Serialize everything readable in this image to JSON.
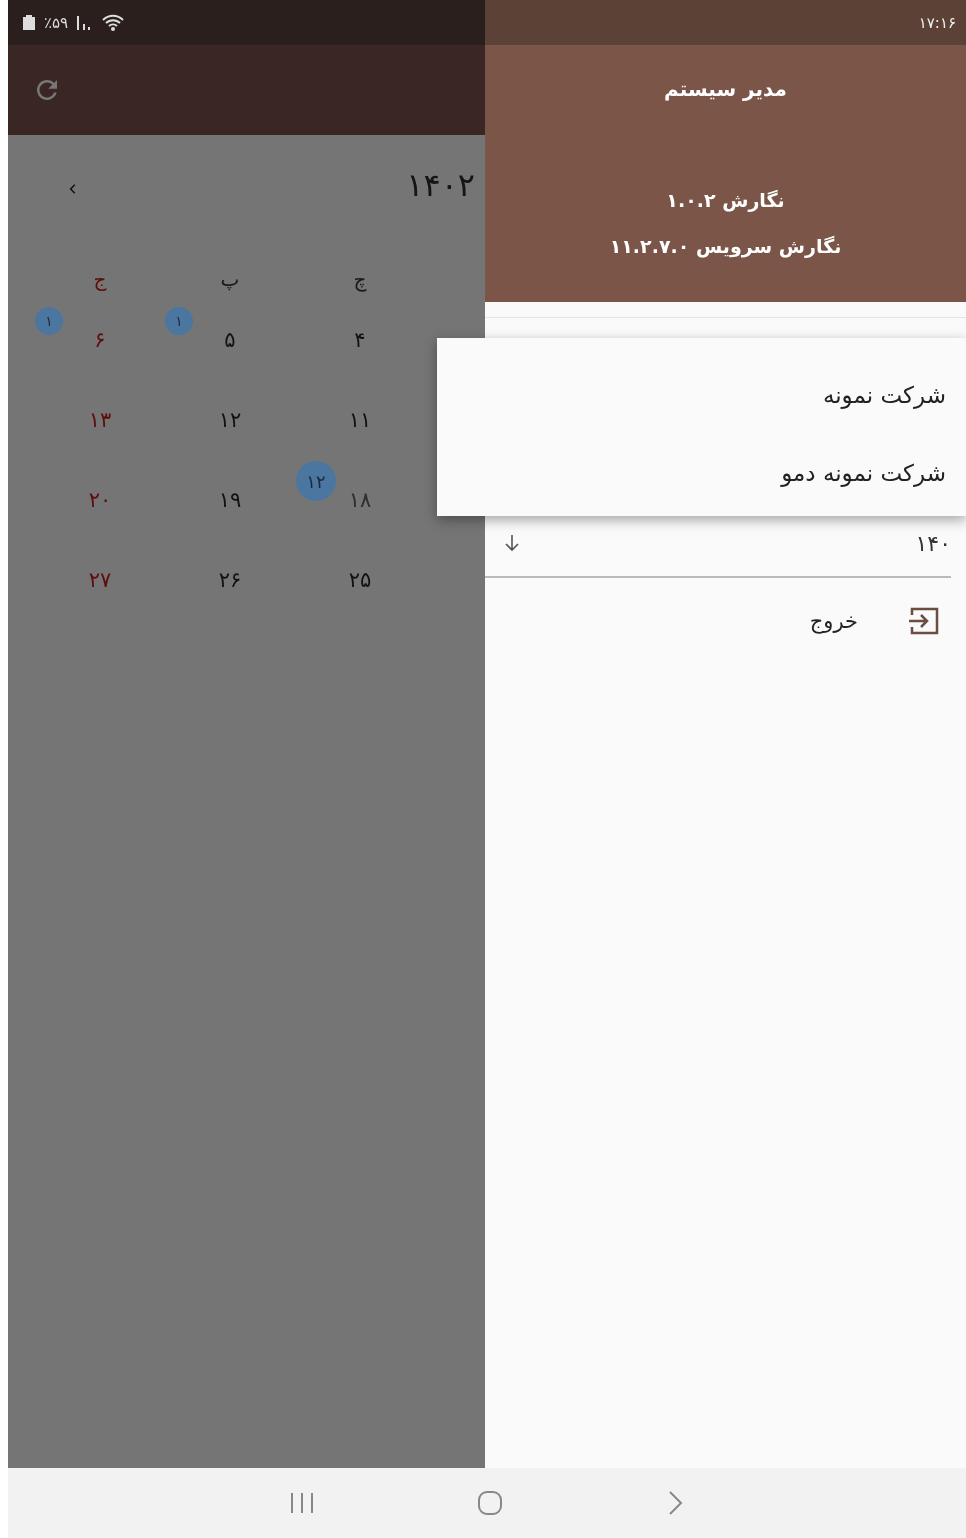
{
  "status_bar": {
    "battery": "٪۵۹",
    "time": "۱۷:۱۶"
  },
  "calendar": {
    "year": "۱۴۰۲",
    "weekdays": [
      {
        "label": "چ",
        "holiday": false
      },
      {
        "label": "پ",
        "holiday": false
      },
      {
        "label": "ج",
        "holiday": true
      }
    ],
    "weeks": [
      [
        {
          "day": "۴",
          "holiday": false,
          "muted": false
        },
        {
          "day": "۵",
          "holiday": false,
          "muted": false,
          "badge": "۱"
        },
        {
          "day": "۶",
          "holiday": true,
          "muted": false,
          "badge": "۱"
        }
      ],
      [
        {
          "day": "۱۱",
          "holiday": false,
          "muted": false
        },
        {
          "day": "۱۲",
          "holiday": false,
          "muted": false
        },
        {
          "day": "۱۳",
          "holiday": true,
          "muted": false
        }
      ],
      [
        {
          "day": "۱۸",
          "holiday": false,
          "muted": true,
          "badge": "۱۲"
        },
        {
          "day": "۱۹",
          "holiday": false,
          "muted": false
        },
        {
          "day": "۲۰",
          "holiday": true,
          "muted": false
        }
      ],
      [
        {
          "day": "۲۵",
          "holiday": false,
          "muted": false
        },
        {
          "day": "۲۶",
          "holiday": false,
          "muted": false
        },
        {
          "day": "۲۷",
          "holiday": true,
          "muted": false
        }
      ]
    ]
  },
  "drawer": {
    "title": "مدیر سیستم",
    "version": "نگارش ۱.۰.۲",
    "service_version": "نگارش سرویس ۱۱.۲.۷.۰",
    "year_field": {
      "value": "۱۴۰"
    },
    "menu_items": [
      {
        "label": "خروج"
      }
    ]
  },
  "company_menu": {
    "items": [
      {
        "label": "شرکت نمونه"
      },
      {
        "label": "شرکت نمونه دمو"
      }
    ]
  }
}
